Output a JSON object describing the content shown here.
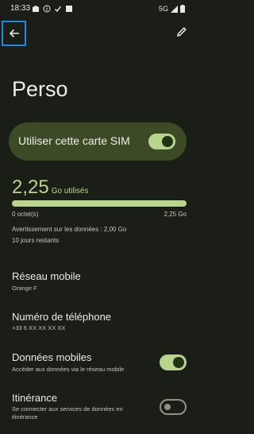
{
  "status_bar": {
    "time": "18:33",
    "network": "5G"
  },
  "header": {
    "title": "Perso"
  },
  "sim": {
    "label": "Utiliser cette carte SIM",
    "enabled": true
  },
  "usage": {
    "amount": "2,25",
    "unit": "Go utilisés",
    "fraction": 1.0,
    "min_label": "0 octet(s)",
    "max_label": "2,25 Go",
    "warning": "Avertissement sur les données : 2,00 Go",
    "days_left": "10 jours restants"
  },
  "mobile_network": {
    "title": "Réseau mobile",
    "value": "Orange F"
  },
  "phone_number": {
    "title": "Numéro de téléphone",
    "value": "+33 6 XX XX XX XX"
  },
  "mobile_data": {
    "title": "Données mobiles",
    "subtitle": "Accéder aux données via le réseau mobile",
    "enabled": true
  },
  "roaming": {
    "title": "Itinérance",
    "subtitle_line1": "Se connecter aux services de données en",
    "subtitle_line2": "itinérance",
    "enabled": false
  },
  "colors": {
    "accent": "#b9d48d",
    "card": "#3c4a26",
    "background": "#1b1d17",
    "highlight_box": "#1f88e5"
  }
}
